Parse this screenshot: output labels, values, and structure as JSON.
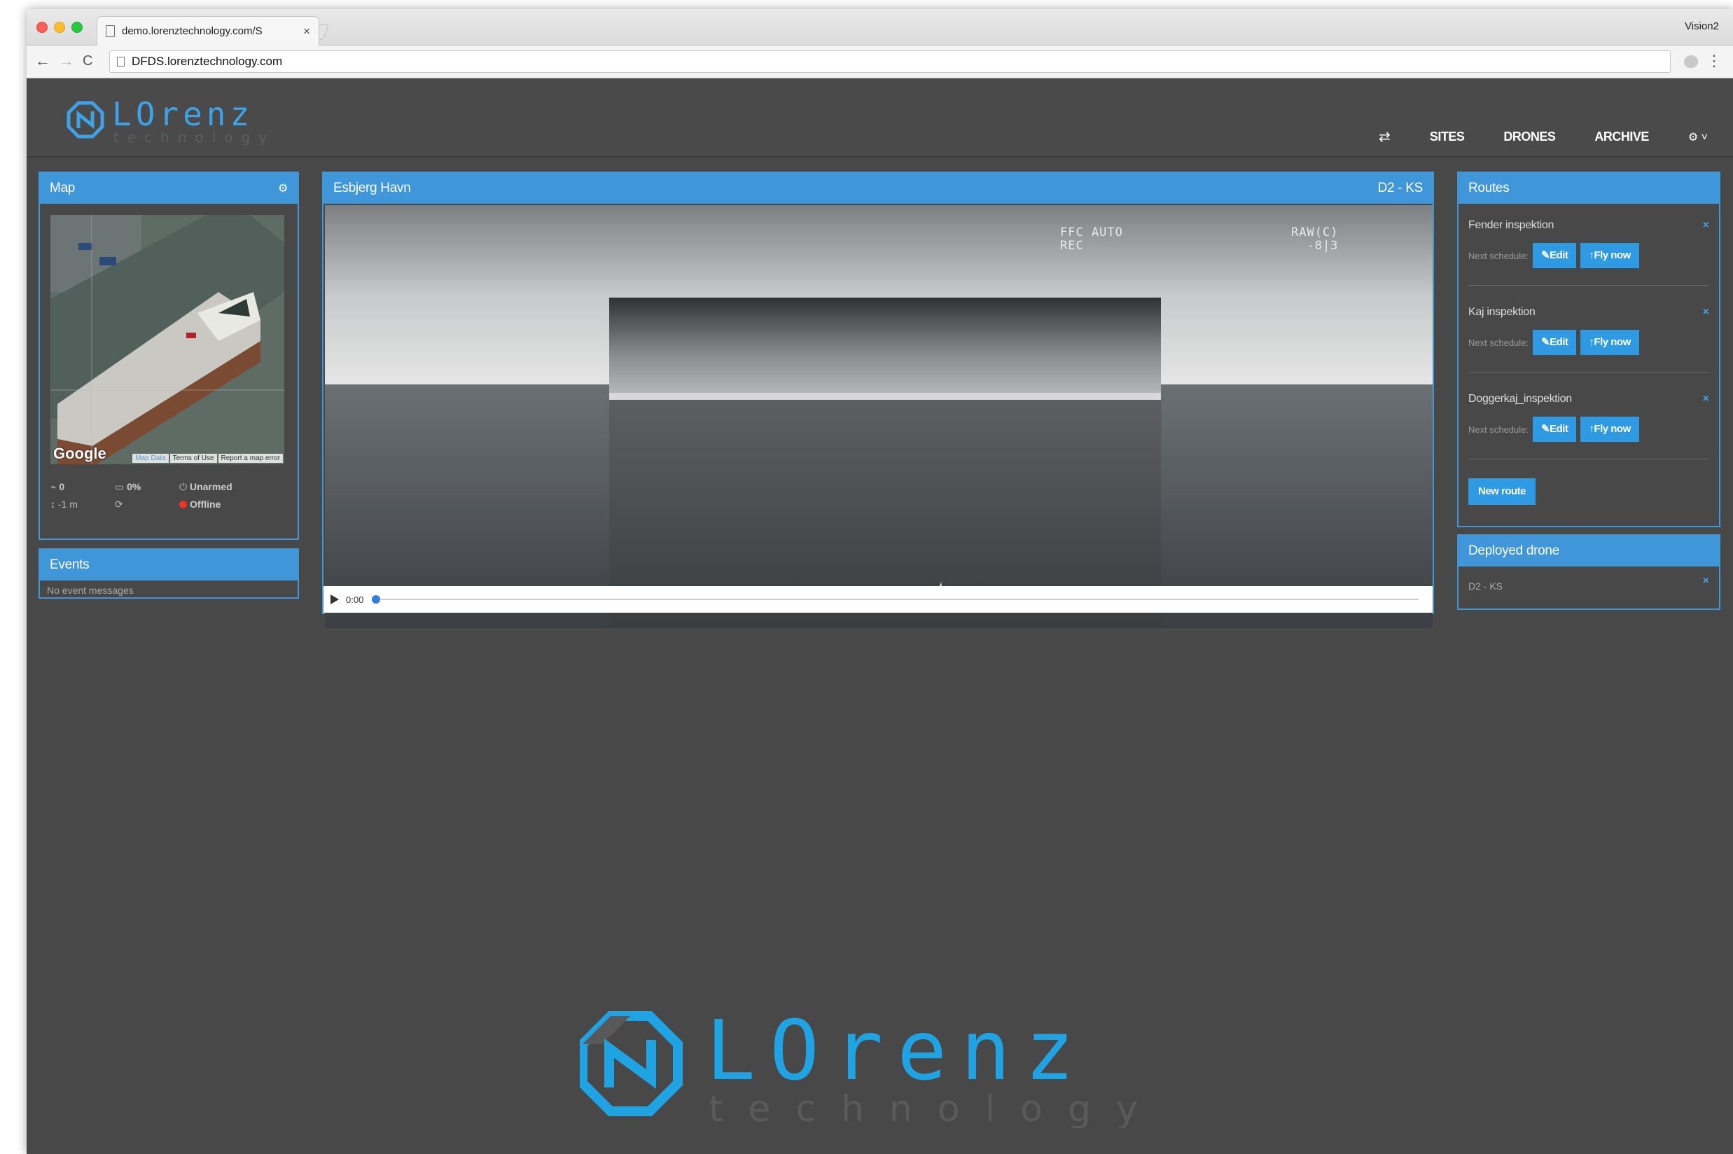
{
  "browser": {
    "tab_title": "demo.lorenztechnology.com/S",
    "tab_close": "×",
    "profile": "Vision2",
    "url": "DFDS.lorenztechnology.com",
    "back": "←",
    "forward": "→",
    "reload": "C",
    "menu": "⋮"
  },
  "brand": {
    "name": "LOrenz",
    "tagline": "technology",
    "primary_color": "#3fa1e6"
  },
  "nav": {
    "swap_icon": "⇄",
    "items": [
      "SITES",
      "DRONES",
      "ARCHIVE"
    ],
    "settings_icon": "⚙ ˅"
  },
  "map_panel": {
    "title": "Map",
    "settings_icon": "⚙",
    "google": "Google",
    "links": [
      "Map Data",
      "Terms of Use",
      "Report a map error"
    ],
    "status": {
      "satellites": "0",
      "battery": "0%",
      "armed": "Unarmed",
      "altitude": "-1 m",
      "connection": "Offline"
    }
  },
  "events_panel": {
    "title": "Events",
    "empty": "No event messages"
  },
  "video_panel": {
    "site": "Esbjerg Havn",
    "drone": "D2 - KS",
    "osd_left": [
      "FFC AUTO",
      "REC"
    ],
    "osd_right": [
      "RAW(C)",
      "-8|3"
    ],
    "time": "0:00",
    "progress": 0
  },
  "routes_panel": {
    "title": "Routes",
    "schedule_label": "Next schedule:",
    "edit_label": "✎Edit",
    "fly_label": "↑Fly now",
    "close": "×",
    "routes": [
      {
        "name": "Fender inspektion"
      },
      {
        "name": "Kaj inspektion"
      },
      {
        "name": "Doggerkaj_inspektion"
      }
    ],
    "new_route": "New route"
  },
  "deployed_panel": {
    "title": "Deployed drone",
    "drone": "D2 - KS",
    "close": "×"
  }
}
